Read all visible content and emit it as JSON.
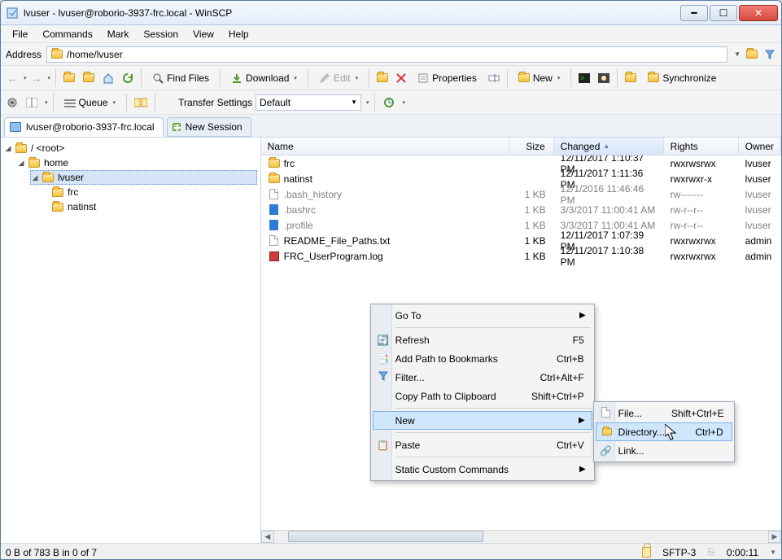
{
  "window": {
    "title": "lvuser - lvuser@roborio-3937-frc.local - WinSCP"
  },
  "menu": {
    "items": [
      "File",
      "Commands",
      "Mark",
      "Session",
      "View",
      "Help"
    ]
  },
  "address": {
    "label": "Address",
    "path": "/home/lvuser"
  },
  "toolbar1": {
    "findfiles": "Find Files",
    "download": "Download",
    "edit": "Edit",
    "properties": "Properties",
    "new": "New",
    "synchronize": "Synchronize"
  },
  "toolbar2": {
    "queue": "Queue",
    "transfer_label": "Transfer Settings",
    "transfer_value": "Default"
  },
  "session": {
    "active": "lvuser@roborio-3937-frc.local",
    "newsession": "New Session"
  },
  "tree": {
    "root": "/ <root>",
    "home": "home",
    "lvuser": "lvuser",
    "frc": "frc",
    "natinst": "natinst"
  },
  "columns": {
    "name": "Name",
    "size": "Size",
    "changed": "Changed",
    "rights": "Rights",
    "owner": "Owner"
  },
  "files": [
    {
      "icon": "folder",
      "name": "frc",
      "size": "",
      "changed": "12/11/2017 1:10:37 PM",
      "rights": "rwxrwsrwx",
      "owner": "lvuser",
      "dim": false
    },
    {
      "icon": "folder",
      "name": "natinst",
      "size": "",
      "changed": "12/11/2017 1:11:36 PM",
      "rights": "rwxrwxr-x",
      "owner": "lvuser",
      "dim": false
    },
    {
      "icon": "doc",
      "name": ".bash_history",
      "size": "1 KB",
      "changed": "12/1/2016 11:46:46 PM",
      "rights": "rw-------",
      "owner": "lvuser",
      "dim": true
    },
    {
      "icon": "vs",
      "name": ".bashrc",
      "size": "1 KB",
      "changed": "3/3/2017 11:00:41 AM",
      "rights": "rw-r--r--",
      "owner": "lvuser",
      "dim": true
    },
    {
      "icon": "vs",
      "name": ".profile",
      "size": "1 KB",
      "changed": "3/3/2017 11:00:41 AM",
      "rights": "rw-r--r--",
      "owner": "lvuser",
      "dim": true
    },
    {
      "icon": "doc",
      "name": "README_File_Paths.txt",
      "size": "1 KB",
      "changed": "12/11/2017 1:07:39 PM",
      "rights": "rwxrwxrwx",
      "owner": "admin",
      "dim": false
    },
    {
      "icon": "red",
      "name": "FRC_UserProgram.log",
      "size": "1 KB",
      "changed": "12/11/2017 1:10:38 PM",
      "rights": "rwxrwxrwx",
      "owner": "admin",
      "dim": false
    }
  ],
  "ctx1": {
    "goto": "Go To",
    "refresh": "Refresh",
    "refresh_sc": "F5",
    "addbm": "Add Path to Bookmarks",
    "addbm_sc": "Ctrl+B",
    "filter": "Filter...",
    "filter_sc": "Ctrl+Alt+F",
    "copypath": "Copy Path to Clipboard",
    "copypath_sc": "Shift+Ctrl+P",
    "new": "New",
    "paste": "Paste",
    "paste_sc": "Ctrl+V",
    "custom": "Static Custom Commands"
  },
  "ctx2": {
    "file": "File...",
    "file_sc": "Shift+Ctrl+E",
    "directory": "Directory...",
    "directory_sc": "Ctrl+D",
    "link": "Link..."
  },
  "status": {
    "left": "0 B of 783 B in 0 of 7",
    "protocol": "SFTP-3",
    "time": "0:00:11"
  }
}
